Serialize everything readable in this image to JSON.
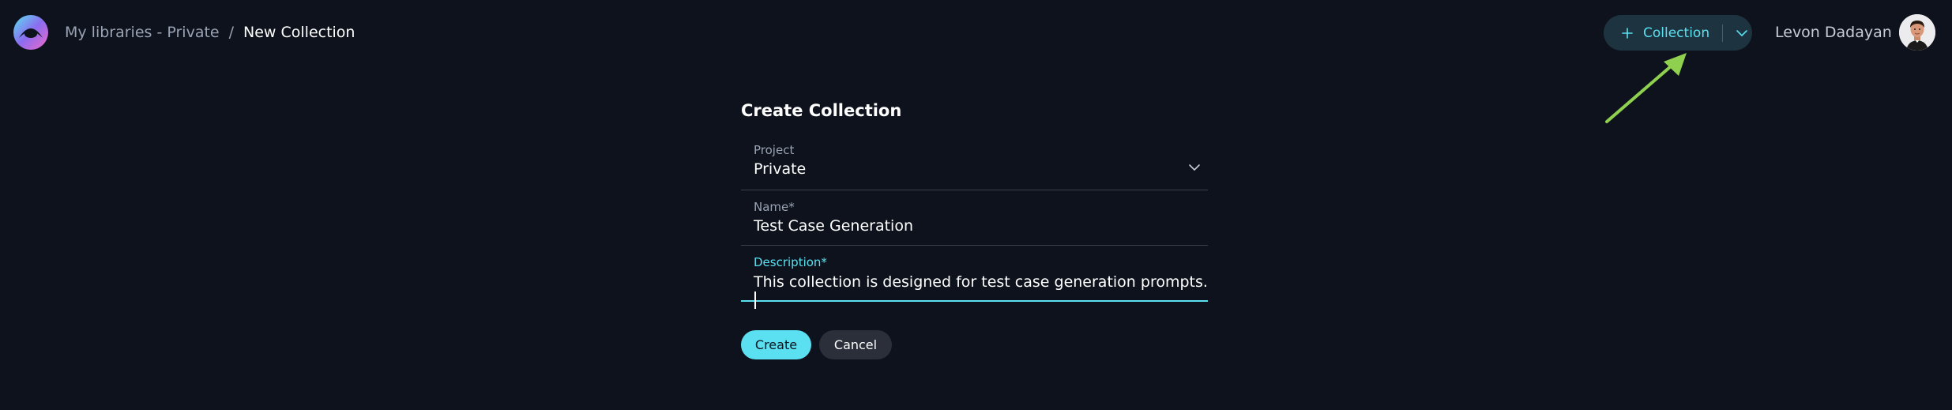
{
  "breadcrumb": {
    "parent": "My libraries - Private",
    "separator": "/",
    "current": "New Collection"
  },
  "header": {
    "collection_button_label": "Collection",
    "user_name": "Levon Dadayan"
  },
  "form": {
    "title": "Create Collection",
    "project": {
      "label": "Project",
      "value": "Private"
    },
    "name": {
      "label": "Name*",
      "value": "Test Case Generation"
    },
    "description": {
      "label": "Description*",
      "value": "This collection is designed for test case generation prompts."
    },
    "create_label": "Create",
    "cancel_label": "Cancel"
  },
  "colors": {
    "background": "#0e121c",
    "accent": "#5ae0f0",
    "collection_button_bg": "#1d3340",
    "annotation_arrow": "#8fd14f"
  },
  "icons": [
    "app-logo-icon",
    "plus-icon",
    "chevron-down-icon",
    "avatar",
    "annotation-arrow"
  ]
}
